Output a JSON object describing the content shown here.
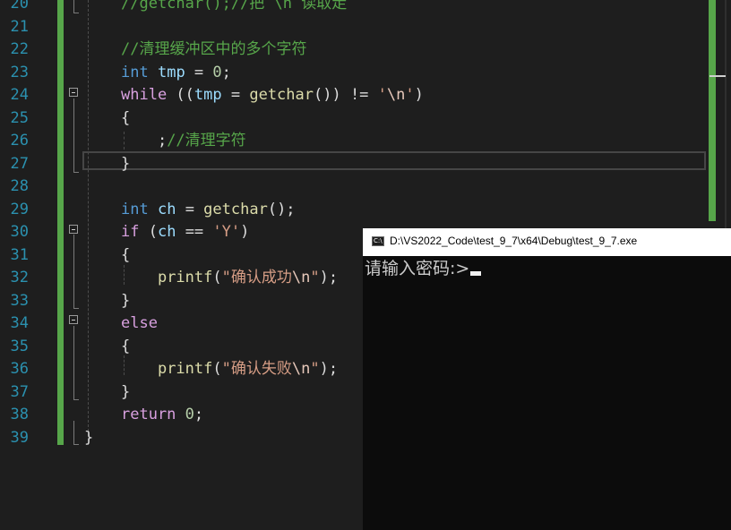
{
  "editor": {
    "line_numbers": [
      "20",
      "21",
      "22",
      "23",
      "24",
      "25",
      "26",
      "27",
      "28",
      "29",
      "30",
      "31",
      "32",
      "33",
      "34",
      "35",
      "36",
      "37",
      "38",
      "39"
    ],
    "lines": [
      [
        {
          "t": "//getchar();//把 \\n 读取走",
          "c": "cm"
        }
      ],
      [],
      [
        {
          "t": "//清理缓冲区中的多个字符",
          "c": "cm"
        }
      ],
      [
        {
          "t": "int",
          "c": "kw"
        },
        {
          "t": " ",
          "c": "plain"
        },
        {
          "t": "tmp",
          "c": "var"
        },
        {
          "t": " = ",
          "c": "plain"
        },
        {
          "t": "0",
          "c": "num"
        },
        {
          "t": ";",
          "c": "plain"
        }
      ],
      [
        {
          "t": "while",
          "c": "kw2"
        },
        {
          "t": " ((",
          "c": "plain"
        },
        {
          "t": "tmp",
          "c": "var"
        },
        {
          "t": " = ",
          "c": "plain"
        },
        {
          "t": "getchar",
          "c": "fn"
        },
        {
          "t": "()) != ",
          "c": "plain"
        },
        {
          "t": "'",
          "c": "str"
        },
        {
          "t": "\\n",
          "c": "esc"
        },
        {
          "t": "'",
          "c": "str"
        },
        {
          "t": ")",
          "c": "plain"
        }
      ],
      [
        {
          "t": "{",
          "c": "plain"
        }
      ],
      [
        {
          "t": "    ;",
          "c": "plain"
        },
        {
          "t": "//清理字符",
          "c": "cm"
        }
      ],
      [
        {
          "t": "}",
          "c": "plain"
        }
      ],
      [],
      [
        {
          "t": "int",
          "c": "kw"
        },
        {
          "t": " ",
          "c": "plain"
        },
        {
          "t": "ch",
          "c": "var"
        },
        {
          "t": " = ",
          "c": "plain"
        },
        {
          "t": "getchar",
          "c": "fn"
        },
        {
          "t": "();",
          "c": "plain"
        }
      ],
      [
        {
          "t": "if",
          "c": "kw2"
        },
        {
          "t": " (",
          "c": "plain"
        },
        {
          "t": "ch",
          "c": "var"
        },
        {
          "t": " == ",
          "c": "plain"
        },
        {
          "t": "'Y'",
          "c": "str"
        },
        {
          "t": ")",
          "c": "plain"
        }
      ],
      [
        {
          "t": "{",
          "c": "plain"
        }
      ],
      [
        {
          "t": "    ",
          "c": "plain"
        },
        {
          "t": "printf",
          "c": "fn"
        },
        {
          "t": "(",
          "c": "plain"
        },
        {
          "t": "\"确认成功",
          "c": "str"
        },
        {
          "t": "\\n",
          "c": "esc"
        },
        {
          "t": "\"",
          "c": "str"
        },
        {
          "t": ");",
          "c": "plain"
        }
      ],
      [
        {
          "t": "}",
          "c": "plain"
        }
      ],
      [
        {
          "t": "else",
          "c": "kw2"
        }
      ],
      [
        {
          "t": "{",
          "c": "plain"
        }
      ],
      [
        {
          "t": "    ",
          "c": "plain"
        },
        {
          "t": "printf",
          "c": "fn"
        },
        {
          "t": "(",
          "c": "plain"
        },
        {
          "t": "\"确认失败",
          "c": "str"
        },
        {
          "t": "\\n",
          "c": "esc"
        },
        {
          "t": "\"",
          "c": "str"
        },
        {
          "t": ");",
          "c": "plain"
        }
      ],
      [
        {
          "t": "}",
          "c": "plain"
        }
      ],
      [
        {
          "t": "return",
          "c": "kw2"
        },
        {
          "t": " ",
          "c": "plain"
        },
        {
          "t": "0",
          "c": "num"
        },
        {
          "t": ";",
          "c": "plain"
        }
      ],
      [
        {
          "t": "}",
          "c": "plain"
        }
      ]
    ],
    "line_indents": [
      1,
      0,
      1,
      1,
      1,
      1,
      1,
      1,
      0,
      1,
      1,
      1,
      1,
      1,
      1,
      1,
      1,
      1,
      1,
      0
    ],
    "fold_lines": [
      "24",
      "30",
      "34"
    ],
    "current_line": "27",
    "colors": {
      "line_number": "#2b91af",
      "keyword": "#569cd6",
      "control_keyword": "#d8a0df",
      "variable": "#9cdcfe",
      "function": "#dcdcaa",
      "string": "#d69d85",
      "comment": "#57a64a",
      "number": "#b5cea8"
    }
  },
  "console": {
    "title": "D:\\VS2022_Code\\test_9_7\\x64\\Debug\\test_9_7.exe",
    "icon": "console-app-icon",
    "icon_text": "C:\\",
    "output": "请输入密码:>"
  }
}
